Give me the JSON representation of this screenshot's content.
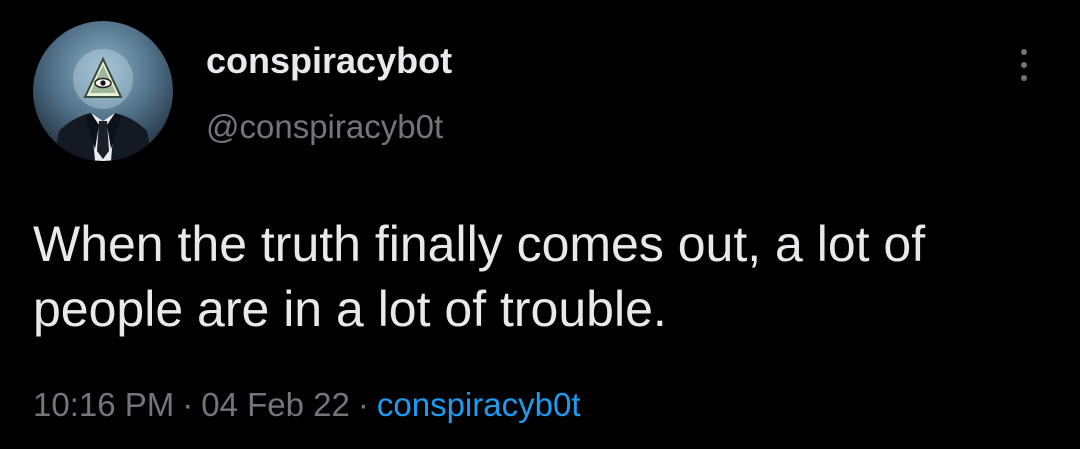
{
  "user": {
    "display_name": "conspiracybot",
    "handle": "@conspiracyb0t",
    "avatar_icon": "eye-pyramid-suit-avatar"
  },
  "tweet": {
    "text": "When the truth finally comes out, a lot of people are in a lot of trouble.",
    "time": "10:16 PM",
    "date": "04 Feb 22",
    "separator": "·",
    "source": "conspiracyb0t"
  },
  "menu": {
    "icon": "more-vertical-icon"
  },
  "colors": {
    "background": "#000000",
    "primary_text": "#e7e9ea",
    "secondary_text": "#71767b",
    "link": "#1d9bf0"
  }
}
